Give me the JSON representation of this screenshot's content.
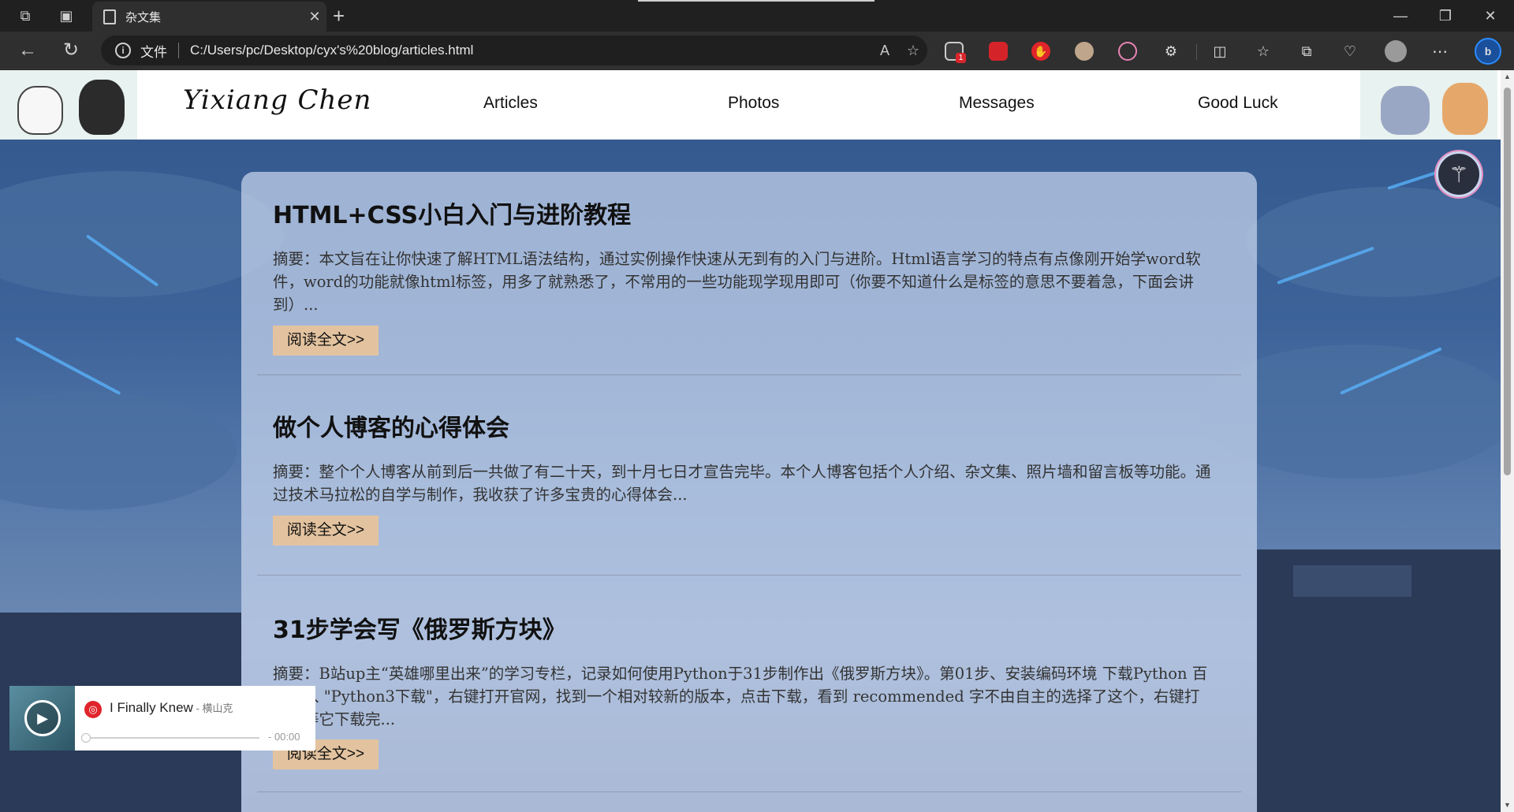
{
  "browser": {
    "tab_title": "杂文集",
    "address_label": "文件",
    "url": "C:/Users/pc/Desktop/cyx's%20blog/articles.html",
    "extension_badge": "1"
  },
  "site": {
    "logo": "Yixiang Chen",
    "nav": [
      "Articles",
      "Photos",
      "Messages",
      "Good Luck"
    ]
  },
  "articles": [
    {
      "title": "HTML+CSS小白入门与进阶教程",
      "summary": "摘要：本文旨在让你快速了解HTML语法结构，通过实例操作快速从无到有的入门与进阶。Html语言学习的特点有点像刚开始学word软件，word的功能就像html标签，用多了就熟悉了，不常用的一些功能现学现用即可（你要不知道什么是标签的意思不要着急，下面会讲到）...",
      "read_more": "阅读全文>>"
    },
    {
      "title": "做个人博客的心得体会",
      "summary": "摘要：整个个人博客从前到后一共做了有二十天，到十月七日才宣告完毕。本个人博客包括个人介绍、杂文集、照片墙和留言板等功能。通过技术马拉松的自学与制作，我收获了许多宝贵的心得体会...",
      "read_more": "阅读全文>>"
    },
    {
      "title": "31步学会写《俄罗斯方块》",
      "summary": "摘要：B站up主“英雄哪里出来”的学习专栏，记录如何使用Python于31步制作出《俄罗斯方块》。第01步、安装编码环境 下载Python  百度输入 \"Python3下载\"，右键打开官网，找到一个相对较新的版本，点击下载，看到 recommended 字不由自主的选择了这个，右键打开，等它下载完...",
      "read_more": "阅读全文>>"
    }
  ],
  "music_player": {
    "song": "I Finally Knew",
    "artist": " - 横山克",
    "time": "- 00:00",
    "progress": 0
  }
}
